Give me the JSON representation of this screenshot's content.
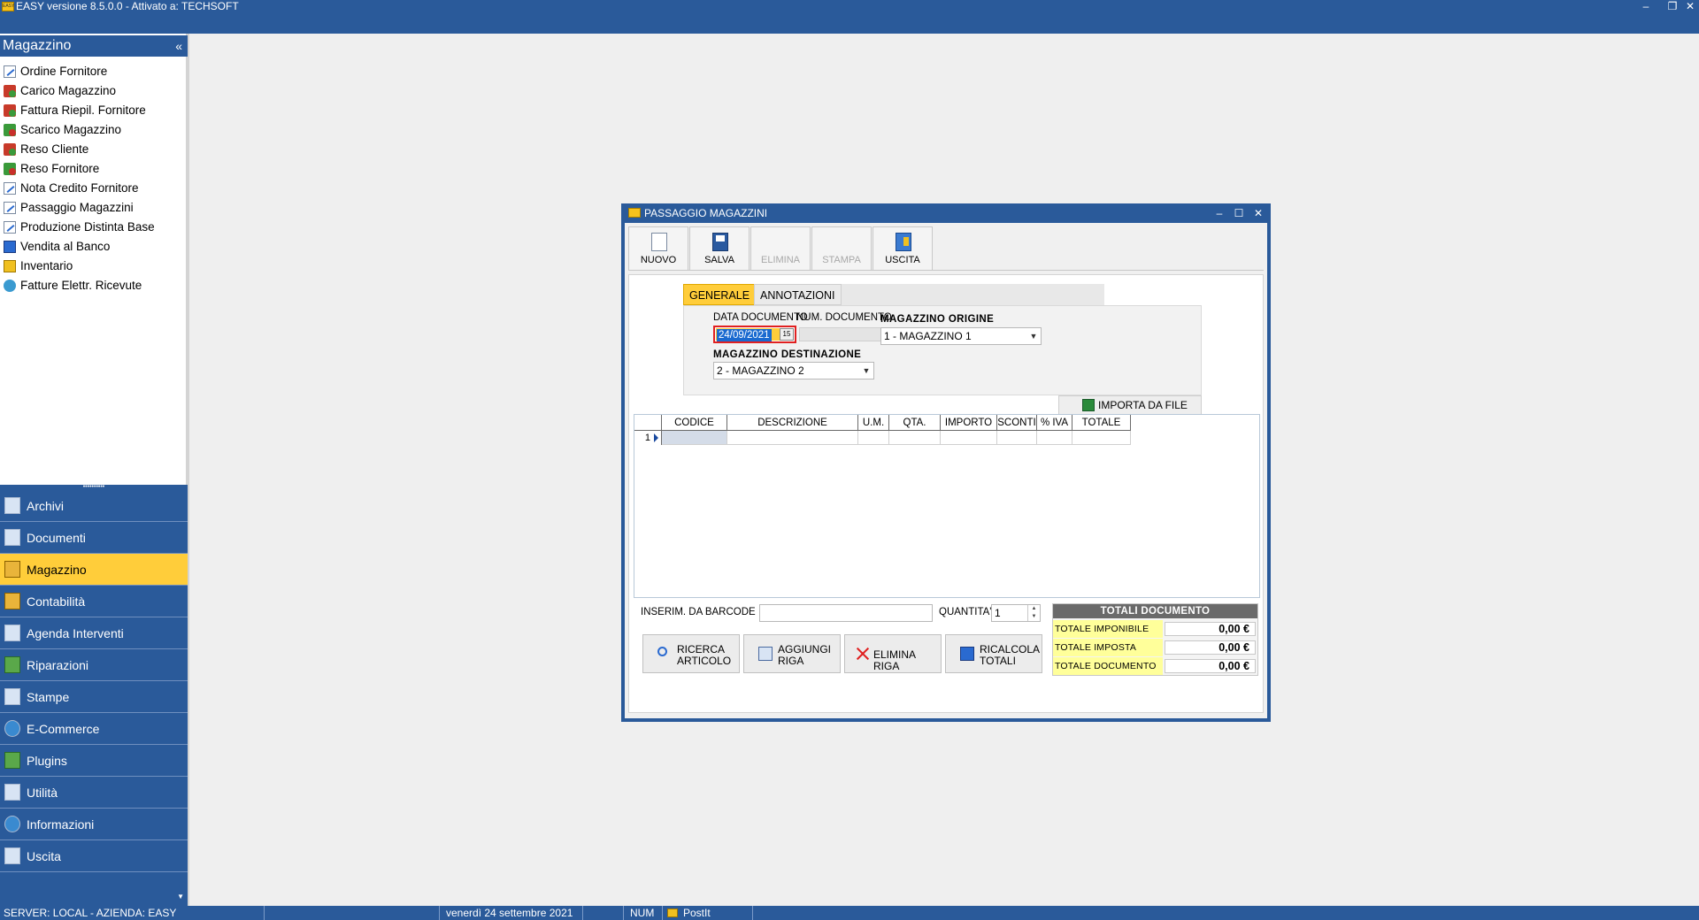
{
  "window": {
    "title": "EASY versione 8.5.0.0 - Attivato a: TECHSOFT",
    "app_icon_text": "EASY",
    "min": "–",
    "restore": "❐",
    "close": "✕"
  },
  "sidebar": {
    "header": "Magazzino",
    "collapse_glyph": "«",
    "items": [
      {
        "label": "Ordine Fornitore",
        "icon": "document-edit-icon"
      },
      {
        "label": "Carico Magazzino",
        "icon": "truck-load-icon"
      },
      {
        "label": "Fattura Riepil. Fornitore",
        "icon": "truck-invoice-icon"
      },
      {
        "label": "Scarico Magazzino",
        "icon": "truck-unload-icon"
      },
      {
        "label": "Reso Cliente",
        "icon": "truck-return-icon"
      },
      {
        "label": "Reso Fornitore",
        "icon": "truck-return-supplier-icon"
      },
      {
        "label": "Nota Credito Fornitore",
        "icon": "document-edit-icon"
      },
      {
        "label": "Passaggio Magazzini",
        "icon": "document-edit-icon"
      },
      {
        "label": "Produzione Distinta Base",
        "icon": "document-edit-icon"
      },
      {
        "label": "Vendita al Banco",
        "icon": "cash-register-icon"
      },
      {
        "label": "Inventario",
        "icon": "inventory-icon"
      },
      {
        "label": "Fatture Elettr. Ricevute",
        "icon": "globe-invoice-icon"
      }
    ],
    "nav": [
      {
        "label": "Archivi",
        "icon": "archive-icon"
      },
      {
        "label": "Documenti",
        "icon": "documents-icon"
      },
      {
        "label": "Magazzino",
        "icon": "warehouse-box-icon",
        "active": true
      },
      {
        "label": "Contabilità",
        "icon": "scales-icon"
      },
      {
        "label": "Agenda Interventi",
        "icon": "agenda-icon"
      },
      {
        "label": "Riparazioni",
        "icon": "repair-icon"
      },
      {
        "label": "Stampe",
        "icon": "printer-icon"
      },
      {
        "label": "E-Commerce",
        "icon": "ecommerce-globe-icon"
      },
      {
        "label": "Plugins",
        "icon": "plugin-icon"
      },
      {
        "label": "Utilità",
        "icon": "tools-icon"
      },
      {
        "label": "Informazioni",
        "icon": "info-icon"
      },
      {
        "label": "Uscita",
        "icon": "exit-icon"
      }
    ]
  },
  "statusbar": {
    "server": "SERVER: LOCAL - AZIENDA: EASY",
    "date": "venerdì 24 settembre 2021",
    "num": "NUM",
    "postit": "PostIt"
  },
  "dialog": {
    "title": "PASSAGGIO MAGAZZINI",
    "toolbar": {
      "new": "NUOVO",
      "save": "SALVA",
      "delete": "ELIMINA",
      "print": "STAMPA",
      "exit": "USCITA"
    },
    "tabs": {
      "general": "GENERALE",
      "notes": "ANNOTAZIONI"
    },
    "form": {
      "date_label": "DATA DOCUMENTO",
      "date_value": "24/09/2021",
      "numdoc_label": "NUM. DOCUMENTO",
      "origin_label": "MAGAZZINO ORIGINE",
      "origin_value": "1 - MAGAZZINO 1",
      "dest_label": "MAGAZZINO DESTINAZIONE",
      "dest_value": "2 - MAGAZZINO 2"
    },
    "import_button": "IMPORTA DA FILE",
    "grid": {
      "columns": [
        "CODICE",
        "DESCRIZIONE",
        "U.M.",
        "QTA.",
        "IMPORTO",
        "SCONTI",
        "% IVA",
        "TOTALE"
      ],
      "row_number": "1"
    },
    "bottom": {
      "barcode_label": "INSERIM. DA BARCODE",
      "barcode_value": "",
      "qty_label": "QUANTITA'",
      "qty_value": "1",
      "btn_search": [
        "RICERCA",
        "ARTICOLO"
      ],
      "btn_add": [
        "AGGIUNGI",
        "RIGA"
      ],
      "btn_delete": "ELIMINA RIGA",
      "btn_recalc": [
        "RICALCOLA",
        "TOTALI"
      ]
    },
    "totals": {
      "header": "TOTALI DOCUMENTO",
      "rows": [
        {
          "label": "TOTALE IMPONIBILE",
          "value": "0,00 €"
        },
        {
          "label": "TOTALE IMPOSTA",
          "value": "0,00 €"
        },
        {
          "label": "TOTALE DOCUMENTO",
          "value": "0,00 €"
        }
      ]
    }
  }
}
